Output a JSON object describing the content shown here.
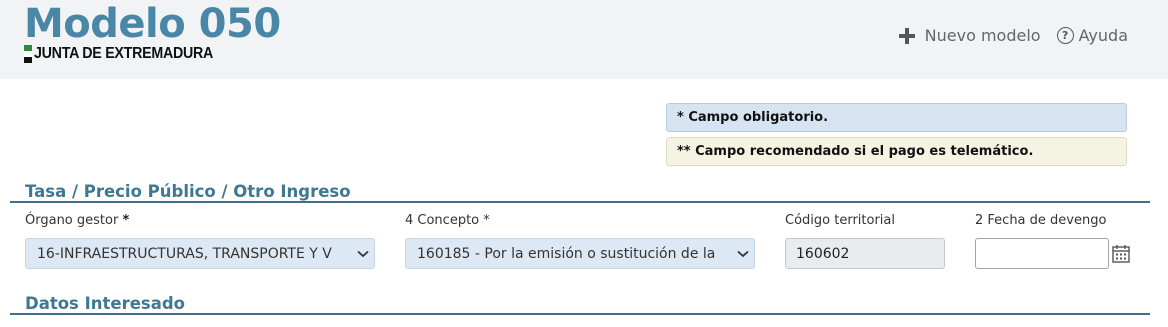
{
  "header": {
    "title": "Modelo 050",
    "subtitle": "JUNTA DE EXTREMADURA",
    "actions": {
      "new_model": "Nuevo modelo",
      "help": "Ayuda",
      "help_glyph": "?"
    }
  },
  "notices": {
    "required": "* Campo obligatorio.",
    "recommended": "** Campo recomendado si el pago es telemático."
  },
  "sections": {
    "tasa": {
      "title": "Tasa / Precio Público / Otro Ingreso",
      "fields": {
        "organo": {
          "label": "Órgano gestor",
          "required_mark": "*",
          "value": "16-INFRAESTRUCTURAS, TRANSPORTE Y V"
        },
        "concepto": {
          "label": "4 Concepto",
          "required_mark": "*",
          "value": "160185 - Por la emisión o sustitución de la"
        },
        "codigo": {
          "label": "Código territorial",
          "value": "160602"
        },
        "fecha": {
          "label": "2 Fecha de devengo",
          "value": ""
        }
      }
    },
    "interesado": {
      "title": "Datos Interesado"
    }
  },
  "colors": {
    "brand": "#4a87a6",
    "section_title": "#3f7891",
    "notice_required_bg": "#d6e4f2",
    "notice_recommended_bg": "#f5f4e3",
    "select_bg": "#dce9f5"
  },
  "icons": [
    "plus-icon",
    "help-icon",
    "chevron-down-icon",
    "calendar-icon",
    "flag-icon"
  ]
}
